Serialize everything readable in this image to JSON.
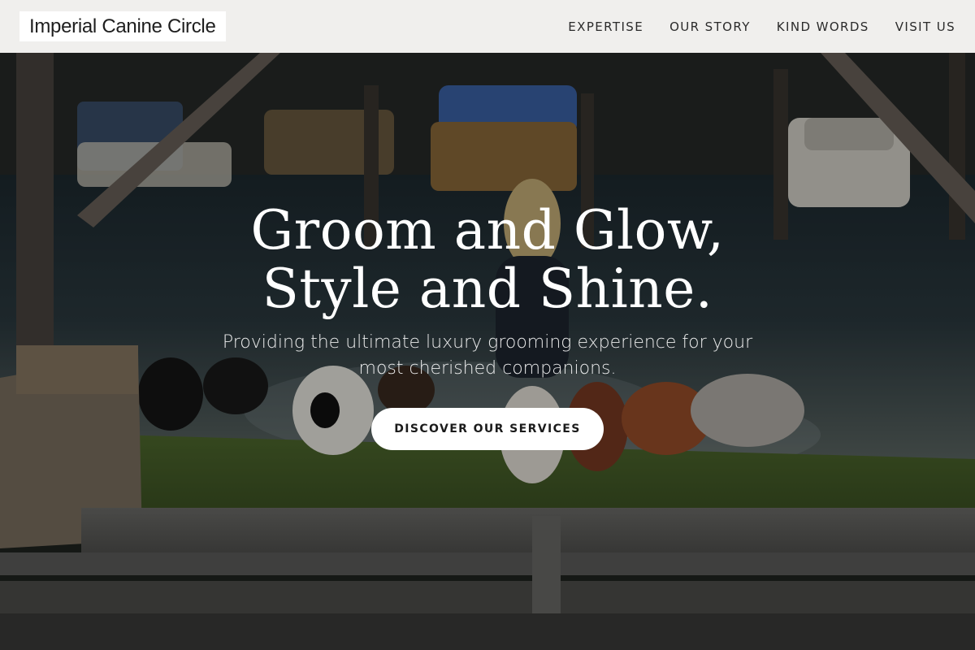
{
  "brand": {
    "name": "Imperial Canine Circle"
  },
  "nav": {
    "items": [
      {
        "label": "EXPERTISE"
      },
      {
        "label": "OUR STORY"
      },
      {
        "label": "KIND WORDS"
      },
      {
        "label": "VISIT US"
      }
    ]
  },
  "hero": {
    "title_line1": "Groom and Glow,",
    "title_line2": "Style and Shine.",
    "subtitle": "Providing the ultimate luxury grooming experience for your most cherished companions.",
    "cta_label": "DISCOVER OUR SERVICES"
  },
  "colors": {
    "header_bg": "#f0efed",
    "logo_bg": "#ffffff",
    "text_dark": "#2b2b2b",
    "hero_text": "#ffffff",
    "button_bg": "#ffffff"
  }
}
